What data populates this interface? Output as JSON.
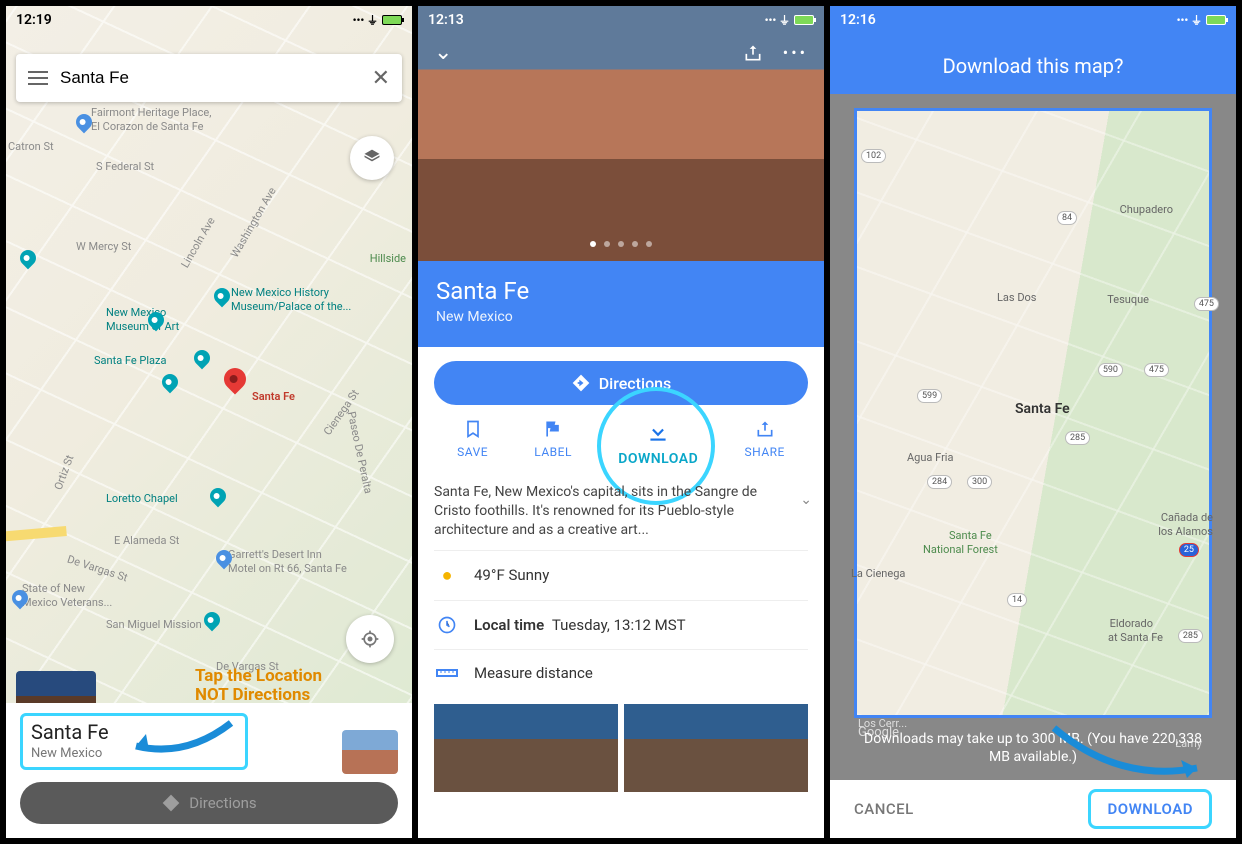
{
  "screen1": {
    "status_time": "12:19",
    "search_value": "Santa Fe",
    "pin_label": "Santa Fe",
    "card_title": "Santa Fe",
    "card_subtitle": "New Mexico",
    "directions_label": "Directions",
    "annotation_line1": "Tap the Location",
    "annotation_line2": "NOT Directions",
    "map_labels": {
      "fairmont1": "Fairmont Heritage Place,",
      "fairmont2": "El Corazon de Santa Fe",
      "catron": "Catron St",
      "federal": "S Federal St",
      "mercy": "W Mercy St",
      "hillside": "Hillside",
      "nmhist1": "New Mexico History",
      "nmhist2": "Museum/Palace of the...",
      "nmart1": "New Mexico",
      "nmart2": "Museum of Art",
      "plaza": "Santa Fe Plaza",
      "loretto": "Loretto Chapel",
      "alameda": "E Alameda St",
      "garrett1": "Garrett's Desert Inn",
      "garrett2": "Motel on Rt 66, Santa Fe",
      "state1": "State of New",
      "state2": "Mexico Veterans...",
      "sanmiguel": "San Miguel Mission",
      "vargas": "De Vargas St",
      "devargas": "De Vargas St",
      "ortiz": "Ortiz St",
      "paseo": "Paseo De Peralta",
      "cienega": "Cienega St",
      "washington": "Washington Ave",
      "lincoln": "Lincoln Ave"
    }
  },
  "screen2": {
    "status_time": "12:13",
    "title": "Santa Fe",
    "subtitle": "New Mexico",
    "directions_label": "Directions",
    "actions": {
      "save": "SAVE",
      "label": "LABEL",
      "download": "DOWNLOAD",
      "share": "SHARE"
    },
    "description": "Santa Fe, New Mexico's capital, sits in the Sangre de Cristo foothills. It's renowned for its Pueblo-style architecture and as a creative art...",
    "weather_text": "49°F Sunny",
    "localtime_label": "Local time",
    "localtime_value": "Tuesday, 13:12 MST",
    "measure_label": "Measure distance"
  },
  "screen3": {
    "status_time": "12:16",
    "header": "Download this map?",
    "note": "Downloads may take up to 300 MB. (You have 220,338 MB available.)",
    "cancel": "CANCEL",
    "download": "DOWNLOAD",
    "map_labels": {
      "santafe": "Santa Fe",
      "aguafria": "Agua Fria",
      "lasdos": "Las Dos",
      "tesuque": "Tesuque",
      "chupadero": "Chupadero",
      "forest1": "Santa Fe",
      "forest2": "National Forest",
      "eldorado1": "Eldorado",
      "eldorado2": "at Santa Fe",
      "lacienega": "La Cienega",
      "canada1": "Cañada de",
      "canada2": "los Alamos",
      "loscerr": "Los Cerr...",
      "lamy": "Lamy",
      "google": "Google",
      "shields": {
        "s102": "102",
        "s84": "84",
        "s599": "599",
        "s285": "285",
        "s284": "284",
        "s300": "300",
        "s475": "475",
        "s590": "590",
        "s14": "14",
        "sI25": "25",
        "s285b": "285"
      }
    }
  }
}
